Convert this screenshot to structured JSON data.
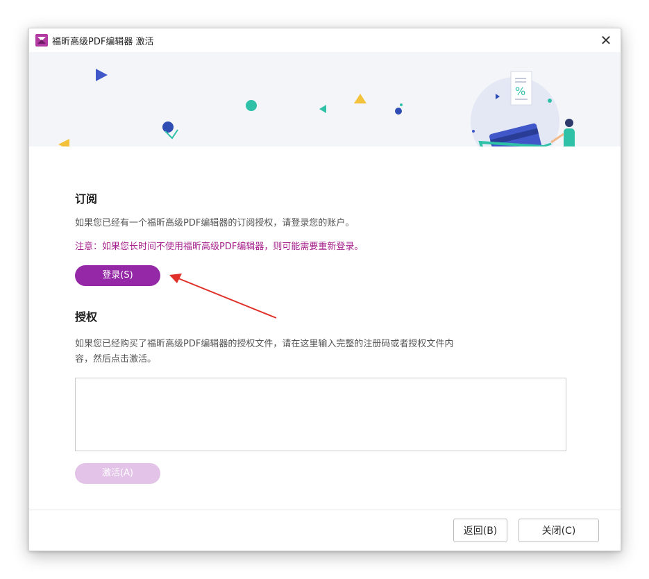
{
  "window": {
    "title": "福昕高级PDF编辑器 激活",
    "close_icon": "close-icon"
  },
  "subscription": {
    "heading": "订阅",
    "description": "如果您已经有一个福昕高级PDF编辑器的订阅授权，请登录您的账户。",
    "note": "注意：如果您长时间不使用福昕高级PDF编辑器，则可能需要重新登录。",
    "login_label": "登录(S)"
  },
  "license": {
    "heading": "授权",
    "description_line1": "如果您已经购买了福昕高级PDF编辑器的授权文件，请在这里输入完整的注册码或者授权文件内",
    "description_line2": "容，然后点击激活。",
    "input_value": "",
    "activate_label": "激活(A)"
  },
  "footer": {
    "back_label": "返回(B)",
    "close_label": "关闭(C)"
  },
  "colors": {
    "accent": "#9528a7",
    "accent_disabled": "#e3c3e8",
    "note": "#a51f8b",
    "arrow": "#e0302a"
  }
}
